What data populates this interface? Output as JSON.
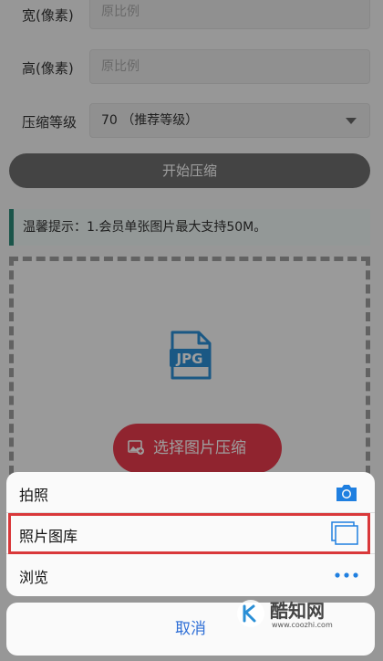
{
  "form": {
    "width_label": "宽(像素)",
    "width_placeholder": "原比例",
    "height_label": "高(像素)",
    "height_placeholder": "原比例",
    "quality_label": "压缩等级",
    "quality_value": "70 （推荐等级）",
    "start_button": "开始压缩"
  },
  "tip": "温馨提示：1.会员单张图片最大支持50M。",
  "upload": {
    "file_icon_text": "JPG",
    "choose_button": "选择图片压缩"
  },
  "action_sheet": {
    "items": [
      {
        "label": "拍照",
        "icon": "camera-icon"
      },
      {
        "label": "照片图库",
        "icon": "photo-library-icon"
      },
      {
        "label": "浏览",
        "icon": "more-icon"
      }
    ],
    "cancel": "取消"
  },
  "watermark": {
    "name": "酷知网",
    "url": "www.coozhi.com"
  },
  "colors": {
    "accent": "#2f6fd6",
    "choose_button": "#e83b4c",
    "tip_bar": "#2c8a78",
    "highlight": "#d9383a"
  }
}
